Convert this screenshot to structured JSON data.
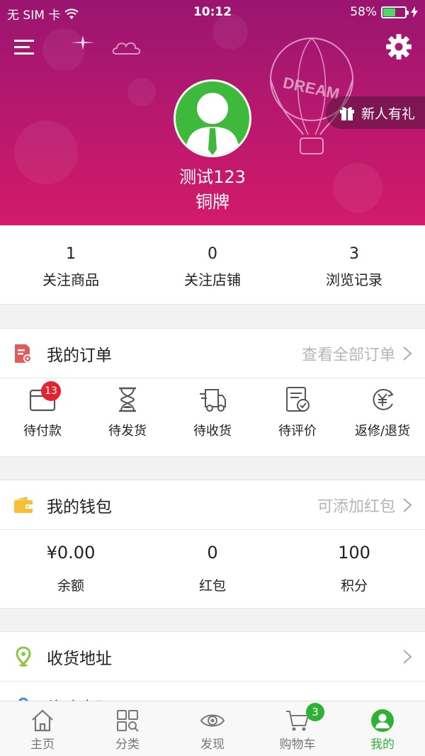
{
  "status_bar": {
    "carrier": "无 SIM 卡",
    "time": "10:12",
    "battery": "58%",
    "battery_level": 0.58
  },
  "profile": {
    "username": "测试123",
    "level": "铜牌",
    "gift_label": "新人有礼",
    "balloon_text": "DREAM"
  },
  "stats": [
    {
      "value": "1",
      "label": "关注商品"
    },
    {
      "value": "0",
      "label": "关注店铺"
    },
    {
      "value": "3",
      "label": "浏览记录"
    }
  ],
  "orders": {
    "title": "我的订单",
    "more": "查看全部订单",
    "items": [
      {
        "label": "待付款",
        "badge": "13",
        "icon": "wallet-card-icon"
      },
      {
        "label": "待发货",
        "icon": "hourglass-icon"
      },
      {
        "label": "待收货",
        "icon": "delivery-truck-icon"
      },
      {
        "label": "待评价",
        "icon": "review-doc-icon"
      },
      {
        "label": "返修/退货",
        "icon": "yen-return-icon"
      }
    ]
  },
  "wallet": {
    "title": "我的钱包",
    "more": "可添加红包",
    "items": [
      {
        "value": "¥0.00",
        "label": "余额"
      },
      {
        "value": "0",
        "label": "红包"
      },
      {
        "value": "100",
        "label": "积分"
      }
    ]
  },
  "address": {
    "title": "收货地址"
  },
  "partial_next": {
    "title": "修改密码"
  },
  "tabbar": {
    "tabs": [
      {
        "label": "主页",
        "icon": "home-icon"
      },
      {
        "label": "分类",
        "icon": "category-icon"
      },
      {
        "label": "发现",
        "icon": "eye-icon"
      },
      {
        "label": "购物车",
        "icon": "cart-icon",
        "badge": "3"
      },
      {
        "label": "我的",
        "icon": "user-icon",
        "active": true
      }
    ]
  },
  "colors": {
    "accent_green": "#2fb135",
    "header_magenta": "#b4186f",
    "badge_red": "#e4232e"
  }
}
